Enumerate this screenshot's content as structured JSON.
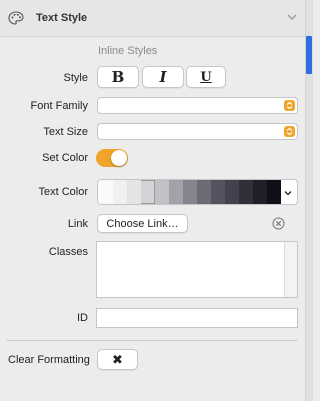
{
  "header": {
    "title": "Text Style",
    "icon": "palette-icon",
    "chevron": "chevron-down-icon"
  },
  "section_title": "Inline Styles",
  "style_row": {
    "label": "Style",
    "bold_label": "B",
    "italic_label": "I",
    "underline_label": "U"
  },
  "font_family": {
    "label": "Font Family",
    "value": ""
  },
  "text_size": {
    "label": "Text Size",
    "value": ""
  },
  "set_color": {
    "label": "Set Color",
    "on": true
  },
  "text_color": {
    "label": "Text Color",
    "swatches": [
      "#fafafa",
      "#f0f0f0",
      "#e4e4e4",
      "#d4d4d6",
      "#c2c2c6",
      "#a2a2a8",
      "#85858d",
      "#6b6b75",
      "#545460",
      "#42424e",
      "#30303b",
      "#1f1f29",
      "#0f0f17"
    ],
    "selected_index": 3
  },
  "link": {
    "label": "Link",
    "button_label": "Choose Link…"
  },
  "classes": {
    "label": "Classes",
    "value": ""
  },
  "id_field": {
    "label": "ID",
    "value": ""
  },
  "clear_formatting": {
    "label": "Clear Formatting",
    "button_glyph": "✖"
  },
  "colors": {
    "accent": "#f0a42a",
    "scroll_thumb": "#2e6de0"
  }
}
